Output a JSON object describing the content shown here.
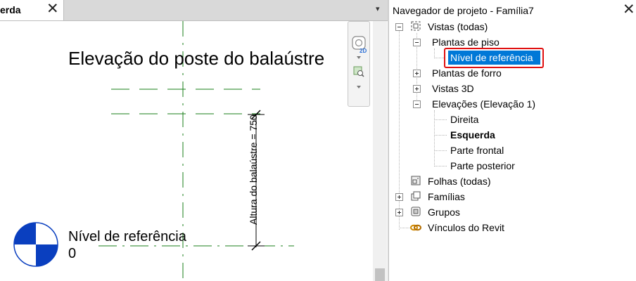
{
  "view_tab": {
    "label": "erda",
    "close_symbol": "✕"
  },
  "canvas": {
    "title": "Elevação do poste do balaústre",
    "level_name": "Nível de referência",
    "level_value": "0",
    "dimension_text": "Altura do balaústre = 750"
  },
  "nav_bar": {
    "label_2d": "2D"
  },
  "pane_menu_symbol": "▾",
  "browser": {
    "title": "Navegador de projeto - Família7",
    "close_symbol": "✕",
    "tree": {
      "views": "Vistas (todas)",
      "floor_plans": "Plantas de piso",
      "ref_level": "Nível de referência",
      "ceiling_plans": "Plantas de forro",
      "views_3d": "Vistas 3D",
      "elevations": "Elevações (Elevação 1)",
      "elev_right": "Direita",
      "elev_left": "Esquerda",
      "elev_front": "Parte frontal",
      "elev_back": "Parte posterior",
      "sheets": "Folhas (todas)",
      "families": "Famílias",
      "groups": "Grupos",
      "links": "Vínculos do Revit"
    }
  },
  "colors": {
    "selection": "#0078d7",
    "highlight_border": "#e01010",
    "ref_plane": "#1a7f1a",
    "level_symbol": "#0a3fbf"
  }
}
